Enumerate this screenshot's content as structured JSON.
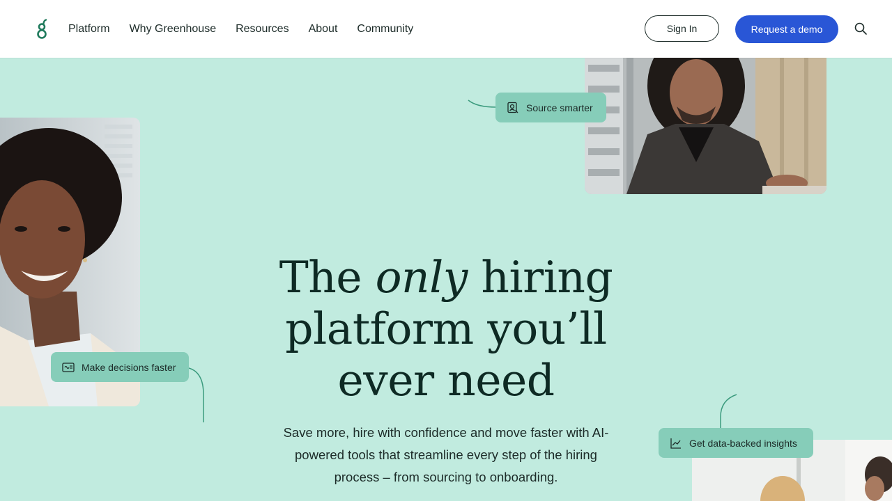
{
  "header": {
    "nav": [
      "Platform",
      "Why Greenhouse",
      "Resources",
      "About",
      "Community"
    ],
    "signin_label": "Sign In",
    "demo_label": "Request a demo",
    "logo_icon": "greenhouse-logo-icon",
    "search_icon": "search-icon"
  },
  "hero": {
    "title_part1": "The",
    "title_emphasis": "only",
    "title_part2": "hiring",
    "title_line2": "platform you’ll",
    "title_line3": "ever need",
    "subtitle": "Save more, hire with confidence and move faster with AI-powered tools that streamline every step of the hiring process – from sourcing to onboarding."
  },
  "callouts": {
    "source": "Source smarter",
    "decisions": "Make decisions faster",
    "insights": "Get data-backed insights"
  },
  "colors": {
    "background": "#c1ebdf",
    "chip": "#86cdb9",
    "primary_button": "#2956d6",
    "brand_green": "#1f7a5c",
    "heading": "#0e2a24"
  }
}
